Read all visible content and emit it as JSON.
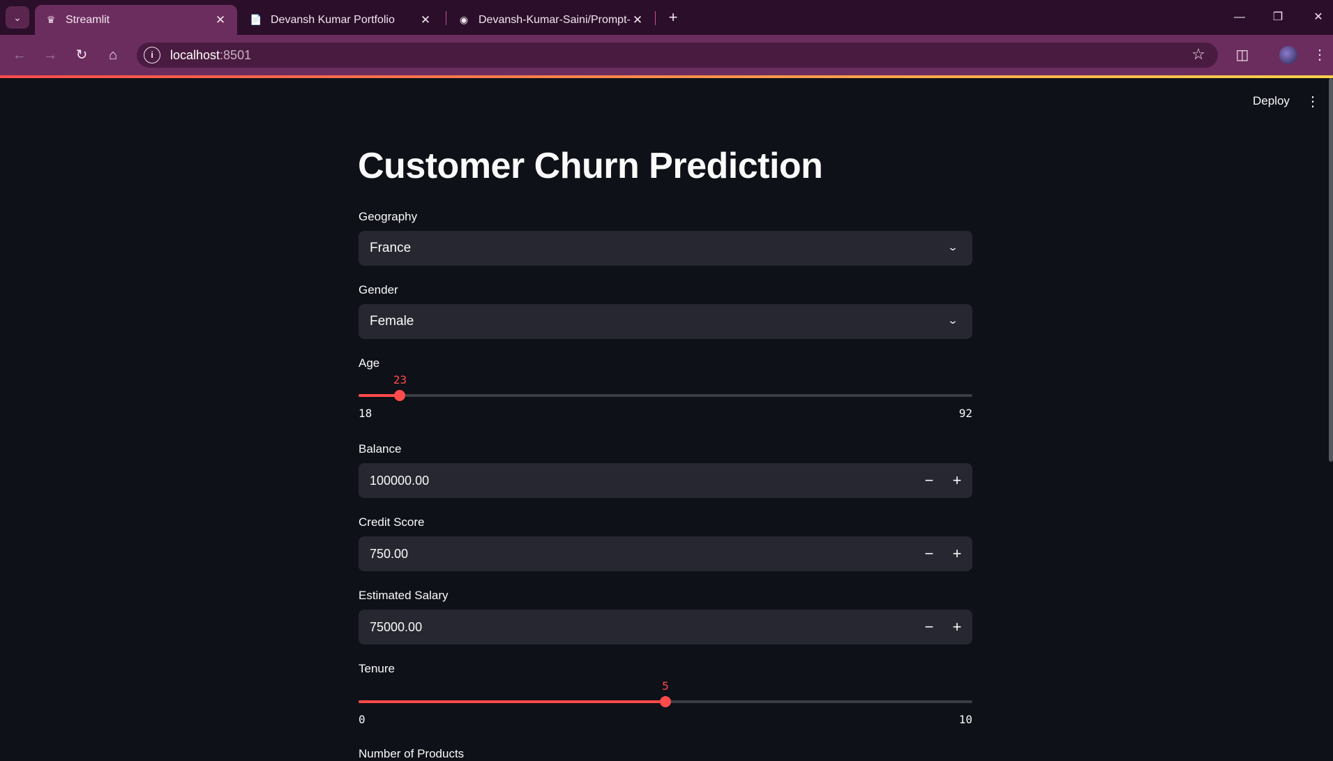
{
  "browser": {
    "tabs": [
      {
        "title": "Streamlit",
        "icon": "streamlit-crown-icon",
        "active": true
      },
      {
        "title": "Devansh Kumar Portfolio",
        "icon": "document-icon",
        "active": false
      },
      {
        "title": "Devansh-Kumar-Saini/Prompt-E",
        "icon": "github-icon",
        "active": false
      }
    ],
    "url_host": "localhost",
    "url_port": ":8501"
  },
  "app": {
    "deploy_label": "Deploy",
    "title": "Customer Churn Prediction",
    "accent_color": "#ff4b4b",
    "geography": {
      "label": "Geography",
      "value": "France"
    },
    "gender": {
      "label": "Gender",
      "value": "Female"
    },
    "age": {
      "label": "Age",
      "value": 23,
      "min": 18,
      "max": 92
    },
    "balance": {
      "label": "Balance",
      "value": "100000.00"
    },
    "credit_score": {
      "label": "Credit Score",
      "value": "750.00"
    },
    "estimated_salary": {
      "label": "Estimated Salary",
      "value": "75000.00"
    },
    "tenure": {
      "label": "Tenure",
      "value": 5,
      "min": 0,
      "max": 10
    },
    "next_label_partial": "Number of Products"
  }
}
